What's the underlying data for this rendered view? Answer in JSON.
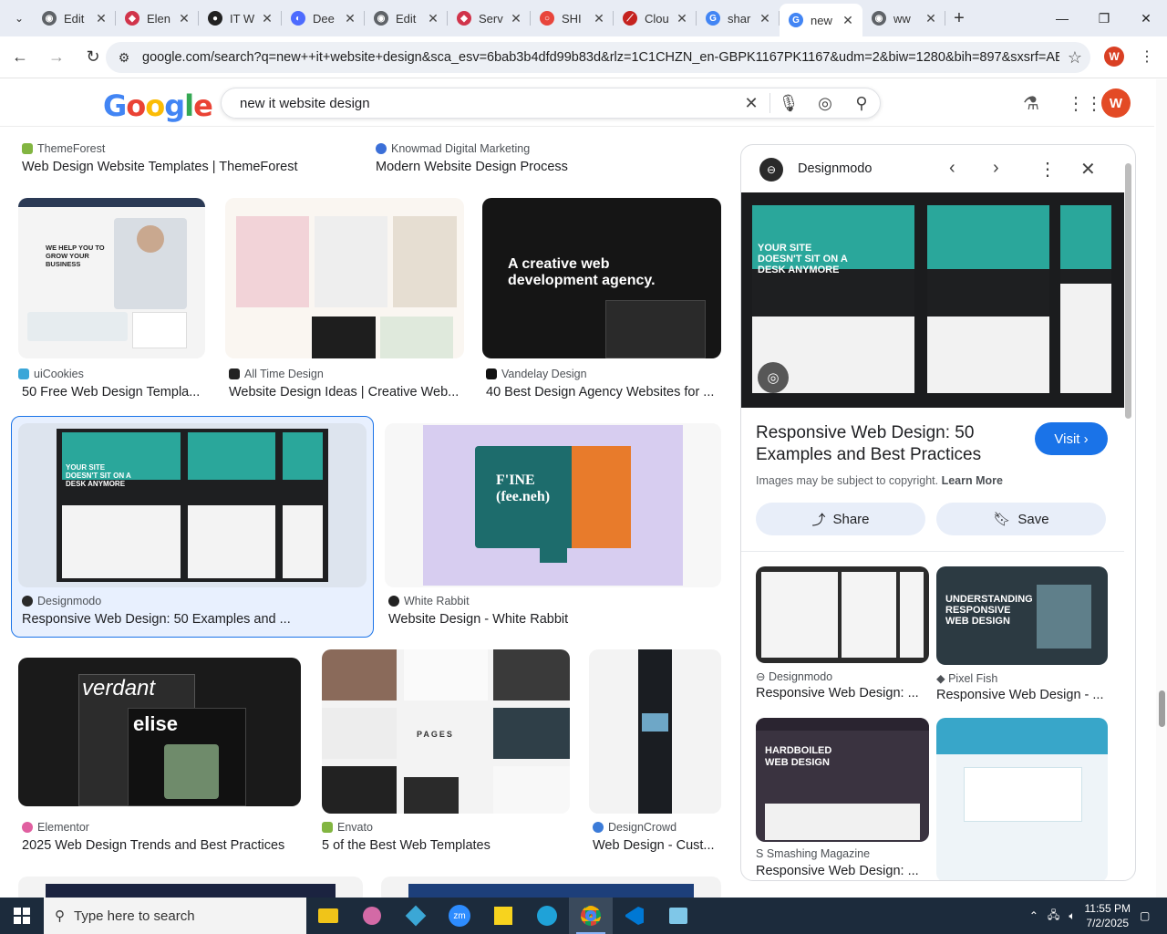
{
  "browser": {
    "tabs": [
      {
        "label": "Edit",
        "icon": "globe-icon",
        "color": "#5f6368"
      },
      {
        "label": "Elen",
        "icon": "elementor-icon",
        "color": "#d1344b"
      },
      {
        "label": "IT W",
        "icon": "itw-icon",
        "color": "#222222"
      },
      {
        "label": "Dee",
        "icon": "deepseek-icon",
        "color": "#4d6bfe"
      },
      {
        "label": "Edit",
        "icon": "globe-icon",
        "color": "#5f6368"
      },
      {
        "label": "Serv",
        "icon": "elementor-icon",
        "color": "#d1344b"
      },
      {
        "label": "SHI",
        "icon": "ring-icon",
        "color": "#e8453c"
      },
      {
        "label": "Clou",
        "icon": "chart-icon",
        "color": "#c5221f"
      },
      {
        "label": "shar",
        "icon": "google-icon",
        "color": "#4285f4"
      },
      {
        "label": "new",
        "icon": "google-icon",
        "color": "#4285f4",
        "active": true
      },
      {
        "label": "ww",
        "icon": "globe-icon",
        "color": "#5f6368"
      }
    ],
    "url": "google.com/search?q=new++it+website+design&sca_esv=6bab3b4dfd99b83d&rlz=1C1CHZN_en-GBPK1167PK1167&udm=2&biw=1280&bih=897&sxsrf=AE...",
    "profile_initial": "W"
  },
  "google": {
    "logo": [
      "G",
      "o",
      "o",
      "g",
      "l",
      "e"
    ],
    "query": "new it website design",
    "avatar_initial": "W"
  },
  "results": [
    {
      "source": "ThemeForest",
      "title": "Web Design Website Templates | ThemeForest",
      "color": "#82b541"
    },
    {
      "source": "Knowmad Digital Marketing",
      "title": "Modern Website Design Process",
      "color": "#3b6fd8"
    },
    {
      "source": "uiCookies",
      "title": "50 Free Web Design Templa...",
      "color": "#3aa6d8"
    },
    {
      "source": "All Time Design",
      "title": "Website Design Ideas | Creative Web...",
      "color": "#222222"
    },
    {
      "source": "Vandelay Design",
      "title": "40 Best Design Agency Websites for ...",
      "color": "#111111"
    },
    {
      "source": "Designmodo",
      "title": "Responsive Web Design: 50 Examples and ...",
      "color": "#2a2a2a"
    },
    {
      "source": "White Rabbit",
      "title": "Website Design - White Rabbit",
      "color": "#222222"
    },
    {
      "source": "Elementor",
      "title": "2025 Web Design Trends and Best Practices",
      "color": "#e05fa0"
    },
    {
      "source": "Envato",
      "title": "5 of the Best Web Templates",
      "color": "#82b541"
    },
    {
      "source": "DesignCrowd",
      "title": "Web Design - Cust...",
      "color": "#3b7bd8"
    }
  ],
  "thumb_text": {
    "ui_hero": "WE HELP YOU TO GROW YOUR BUSINESS",
    "vandelay_hero": "A creative web development agency.",
    "spark_hero": "YOUR SITE DOESN'T SIT ON A DESK ANYMORE",
    "wr_hero": "F'INE (fee.neh)",
    "verdant": "verdant",
    "elise": "elise",
    "pages": "PAGES"
  },
  "panel": {
    "site": "Designmodo",
    "title": "Responsive Web Design: 50 Examples and Best Practices",
    "visit_label": "Visit",
    "copyright": "Images may be subject to copyright.",
    "learn_more": "Learn More",
    "share_label": "Share",
    "save_label": "Save",
    "related": [
      {
        "source": "Designmodo",
        "title": "Responsive Web Design: ..."
      },
      {
        "source": "Pixel Fish",
        "title": "Responsive Web Design - ..."
      },
      {
        "source": "Smashing Magazine",
        "title": "Responsive Web Design: ..."
      }
    ],
    "related_thumb_text": {
      "pixel": "UNDERSTANDING RESPONSIVE WEB DESIGN",
      "hardboiled": "HARDBOILED WEB DESIGN"
    }
  },
  "taskbar": {
    "search_placeholder": "Type here to search",
    "time": "11:55 PM",
    "date": "7/2/2025"
  }
}
